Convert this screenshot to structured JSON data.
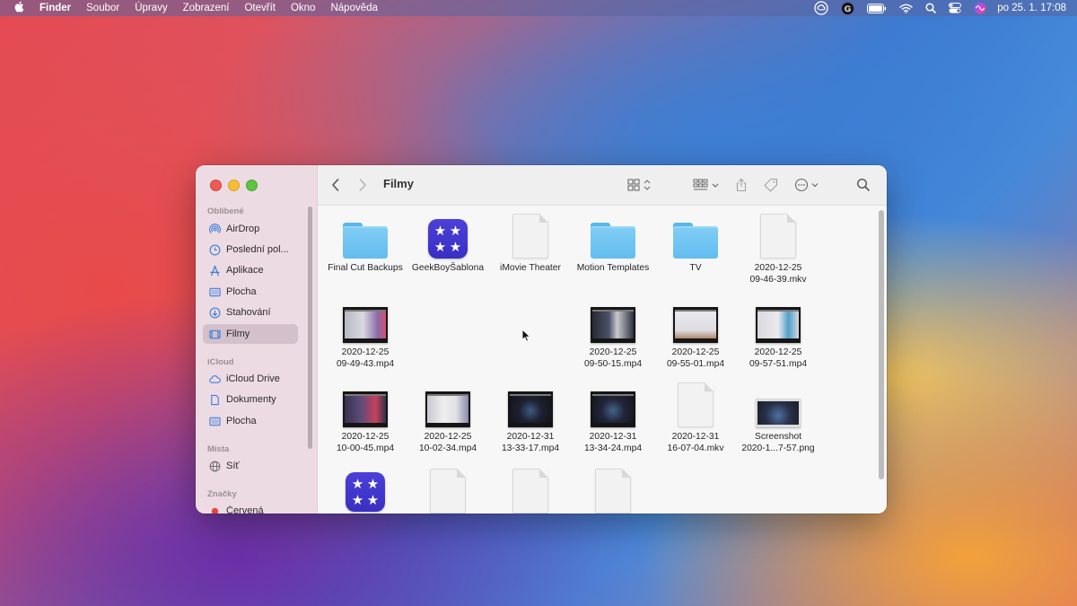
{
  "menubar": {
    "app": "Finder",
    "items": [
      "Soubor",
      "Úpravy",
      "Zobrazení",
      "Otevřít",
      "Okno",
      "Nápověda"
    ],
    "clock": "po 25. 1.  17:08",
    "status_icons": [
      "creative-cloud-icon",
      "grammarly-icon",
      "battery-icon",
      "wifi-icon",
      "search-icon",
      "control-center-icon",
      "siri-icon"
    ]
  },
  "window": {
    "title": "Filmy",
    "sidebar": {
      "favorites_header": "Oblíbené",
      "favorites": [
        {
          "label": "AirDrop",
          "icon": "airdrop-icon"
        },
        {
          "label": "Poslední pol...",
          "icon": "recents-icon"
        },
        {
          "label": "Aplikace",
          "icon": "applications-icon"
        },
        {
          "label": "Plocha",
          "icon": "desktop-icon"
        },
        {
          "label": "Stahování",
          "icon": "downloads-icon"
        },
        {
          "label": "Filmy",
          "icon": "movies-icon",
          "selected": true
        }
      ],
      "icloud_header": "iCloud",
      "icloud": [
        {
          "label": "iCloud Drive",
          "icon": "cloud-icon"
        },
        {
          "label": "Dokumenty",
          "icon": "document-icon"
        },
        {
          "label": "Plocha",
          "icon": "desktop-icon"
        }
      ],
      "places_header": "Místa",
      "places": [
        {
          "label": "Síť",
          "icon": "network-icon"
        }
      ],
      "tags_header": "Značky",
      "tags": [
        {
          "label": "Červená",
          "color": "#e6453d"
        }
      ]
    },
    "files": [
      {
        "name": "Final Cut Backups",
        "kind": "folder"
      },
      {
        "name": "GeekBoyŠablona",
        "kind": "app"
      },
      {
        "name": "iMovie Theater",
        "kind": "doc"
      },
      {
        "name": "Motion Templates",
        "kind": "folder"
      },
      {
        "name": "TV",
        "kind": "folder"
      },
      {
        "name": "2020-12-25 09-46-39.mkv",
        "kind": "doc"
      },
      {
        "name": "2020-12-25 09-49-43.mp4",
        "kind": "video"
      },
      {
        "name": "",
        "kind": "empty"
      },
      {
        "name": "",
        "kind": "empty"
      },
      {
        "name": "2020-12-25 09-50-15.mp4",
        "kind": "video"
      },
      {
        "name": "2020-12-25 09-55-01.mp4",
        "kind": "video"
      },
      {
        "name": "2020-12-25 09-57-51.mp4",
        "kind": "video"
      },
      {
        "name": "2020-12-25 10-00-45.mp4",
        "kind": "video"
      },
      {
        "name": "2020-12-25 10-02-34.mp4",
        "kind": "video"
      },
      {
        "name": "2020-12-31 13-33-17.mp4",
        "kind": "video"
      },
      {
        "name": "2020-12-31 13-34-24.mp4",
        "kind": "video"
      },
      {
        "name": "2020-12-31 16-07-04.mkv",
        "kind": "doc"
      },
      {
        "name": "Screenshot 2020-1...7-57.png",
        "kind": "video"
      },
      {
        "name": "",
        "kind": "app"
      },
      {
        "name": "",
        "kind": "doc"
      },
      {
        "name": "",
        "kind": "doc"
      },
      {
        "name": "",
        "kind": "doc"
      }
    ]
  }
}
